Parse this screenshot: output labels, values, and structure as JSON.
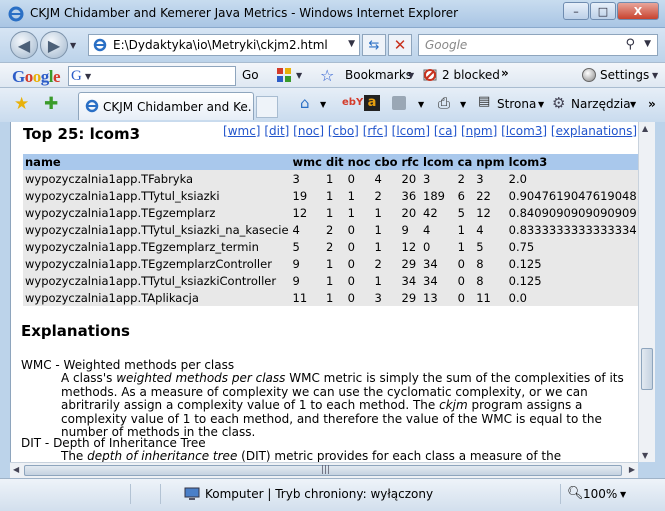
{
  "window": {
    "title": "CKJM Chidamber and Kemerer Java Metrics - Windows Internet Explorer",
    "minimize": "–",
    "maximize": "□",
    "close": "X"
  },
  "address": {
    "url": "E:\\Dydaktyka\\io\\Metryki\\ckjm2.html",
    "search_placeholder": "Google"
  },
  "google_toolbar": {
    "logo": "Google",
    "search_letter": "G",
    "go_label": "Go",
    "bookmarks_label": "Bookmarks",
    "blocked_label": "2 blocked",
    "more_label": "»",
    "settings_label": "Settings"
  },
  "tabs": [
    {
      "label": "CKJM Chidamber and Ke..."
    }
  ],
  "commands": {
    "page_label": "Strona",
    "tools_label": "Narzędzia",
    "more_label": "»"
  },
  "content": {
    "heading": "Top 25: lcom3",
    "metric_links": [
      "wmc",
      "dit",
      "noc",
      "cbo",
      "rfc",
      "lcom",
      "ca",
      "npm",
      "lcom3",
      "explanations"
    ],
    "table": {
      "headers": [
        "name",
        "wmc",
        "dit",
        "noc",
        "cbo",
        "rfc",
        "lcom",
        "ca",
        "npm",
        "lcom3"
      ],
      "rows": [
        [
          "wypozyczalnia1app.TFabryka",
          "3",
          "1",
          "0",
          "4",
          "20",
          "3",
          "2",
          "3",
          "2.0"
        ],
        [
          "wypozyczalnia1app.TTytul_ksiazki",
          "19",
          "1",
          "1",
          "2",
          "36",
          "189",
          "6",
          "22",
          "0.9047619047619048"
        ],
        [
          "wypozyczalnia1app.TEgzemplarz",
          "12",
          "1",
          "1",
          "1",
          "20",
          "42",
          "5",
          "12",
          "0.8409090909090909"
        ],
        [
          "wypozyczalnia1app.TTytul_ksiazki_na_kasecie",
          "4",
          "2",
          "0",
          "1",
          "9",
          "4",
          "1",
          "4",
          "0.8333333333333334"
        ],
        [
          "wypozyczalnia1app.TEgzemplarz_termin",
          "5",
          "2",
          "0",
          "1",
          "12",
          "0",
          "1",
          "5",
          "0.75"
        ],
        [
          "wypozyczalnia1app.TEgzemplarzController",
          "9",
          "1",
          "0",
          "2",
          "29",
          "34",
          "0",
          "8",
          "0.125"
        ],
        [
          "wypozyczalnia1app.TTytul_ksiazkiController",
          "9",
          "1",
          "0",
          "1",
          "34",
          "34",
          "0",
          "8",
          "0.125"
        ],
        [
          "wypozyczalnia1app.TAplikacja",
          "11",
          "1",
          "0",
          "3",
          "29",
          "13",
          "0",
          "11",
          "0.0"
        ]
      ]
    },
    "explanations_heading": "Explanations",
    "wmc_term": "WMC - Weighted methods per class",
    "wmc_text_1": "A class's ",
    "wmc_text_em": "weighted methods per class",
    "wmc_text_2": " WMC metric is simply the sum of the complexities of its methods. As a measure of complexity we can use the cyclomatic complexity, or we can abritrarily assign a complexity value of 1 to each method. The ",
    "wmc_text_em2": "ckjm",
    "wmc_text_3": " program assigns a complexity value of 1 to each method, and therefore the value of the WMC is equal to the number of methods in the class.",
    "dit_term": "DIT - Depth of Inheritance Tree",
    "dit_text_1": "The ",
    "dit_text_em": "depth of inheritance tree",
    "dit_text_2": " (DIT) metric provides for each class a measure of the inheritance"
  },
  "status": {
    "zone": "Komputer | Tryb chroniony: wyłączony",
    "zoom": "100%"
  }
}
